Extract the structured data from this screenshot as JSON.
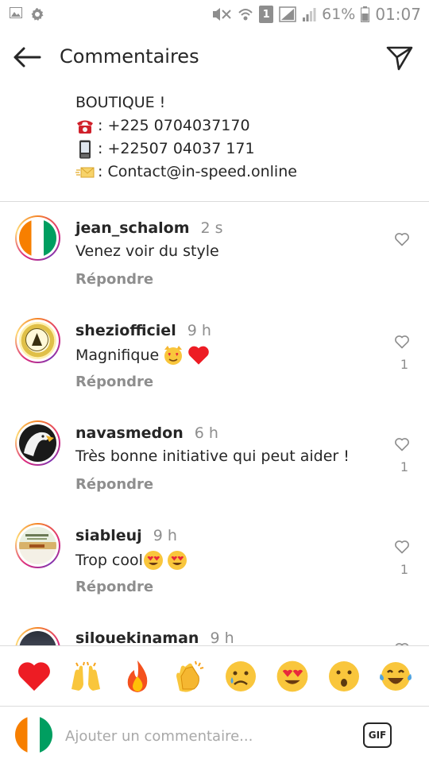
{
  "status_bar": {
    "battery": "61%",
    "time": "01:07",
    "sim_badge": "1"
  },
  "header": {
    "title": "Commentaires"
  },
  "caption": {
    "line1": "BOUTIQUE !",
    "line2": ": +225 0704037170",
    "line3": ": +22507 04037 171",
    "line4": ": Contact@in-speed.online"
  },
  "comments": [
    {
      "username": "jean_schalom",
      "time": "2 s",
      "text": "Venez voir du style",
      "reply": "Répondre",
      "likes": ""
    },
    {
      "username": "shezi­officiel",
      "time": "9 h",
      "text": "Magnifique",
      "reply": "Répondre",
      "likes": "1"
    },
    {
      "username": "navasmedon",
      "time": "6 h",
      "text": "Très bonne initiative qui peut aider !",
      "reply": "Répondre",
      "likes": "1"
    },
    {
      "username": "siableuj",
      "time": "9 h",
      "text": "Trop cool",
      "reply": "Répondre",
      "likes": "1"
    },
    {
      "username": "silouekinaman",
      "time": "9 h",
      "text": "",
      "reply": "",
      "likes": ""
    }
  ],
  "reactions": [
    "heart",
    "raising-hands",
    "fire",
    "clapping-hands",
    "sad-face",
    "heart-eyes",
    "surprised-face",
    "tears-of-joy"
  ],
  "composer": {
    "placeholder": "Ajouter un commentaire...",
    "gif_label": "GIF"
  },
  "colors": {
    "text": "#262626",
    "muted": "#8e8e8e",
    "divider": "#dbdbdb",
    "heart": "#ed1c24"
  }
}
